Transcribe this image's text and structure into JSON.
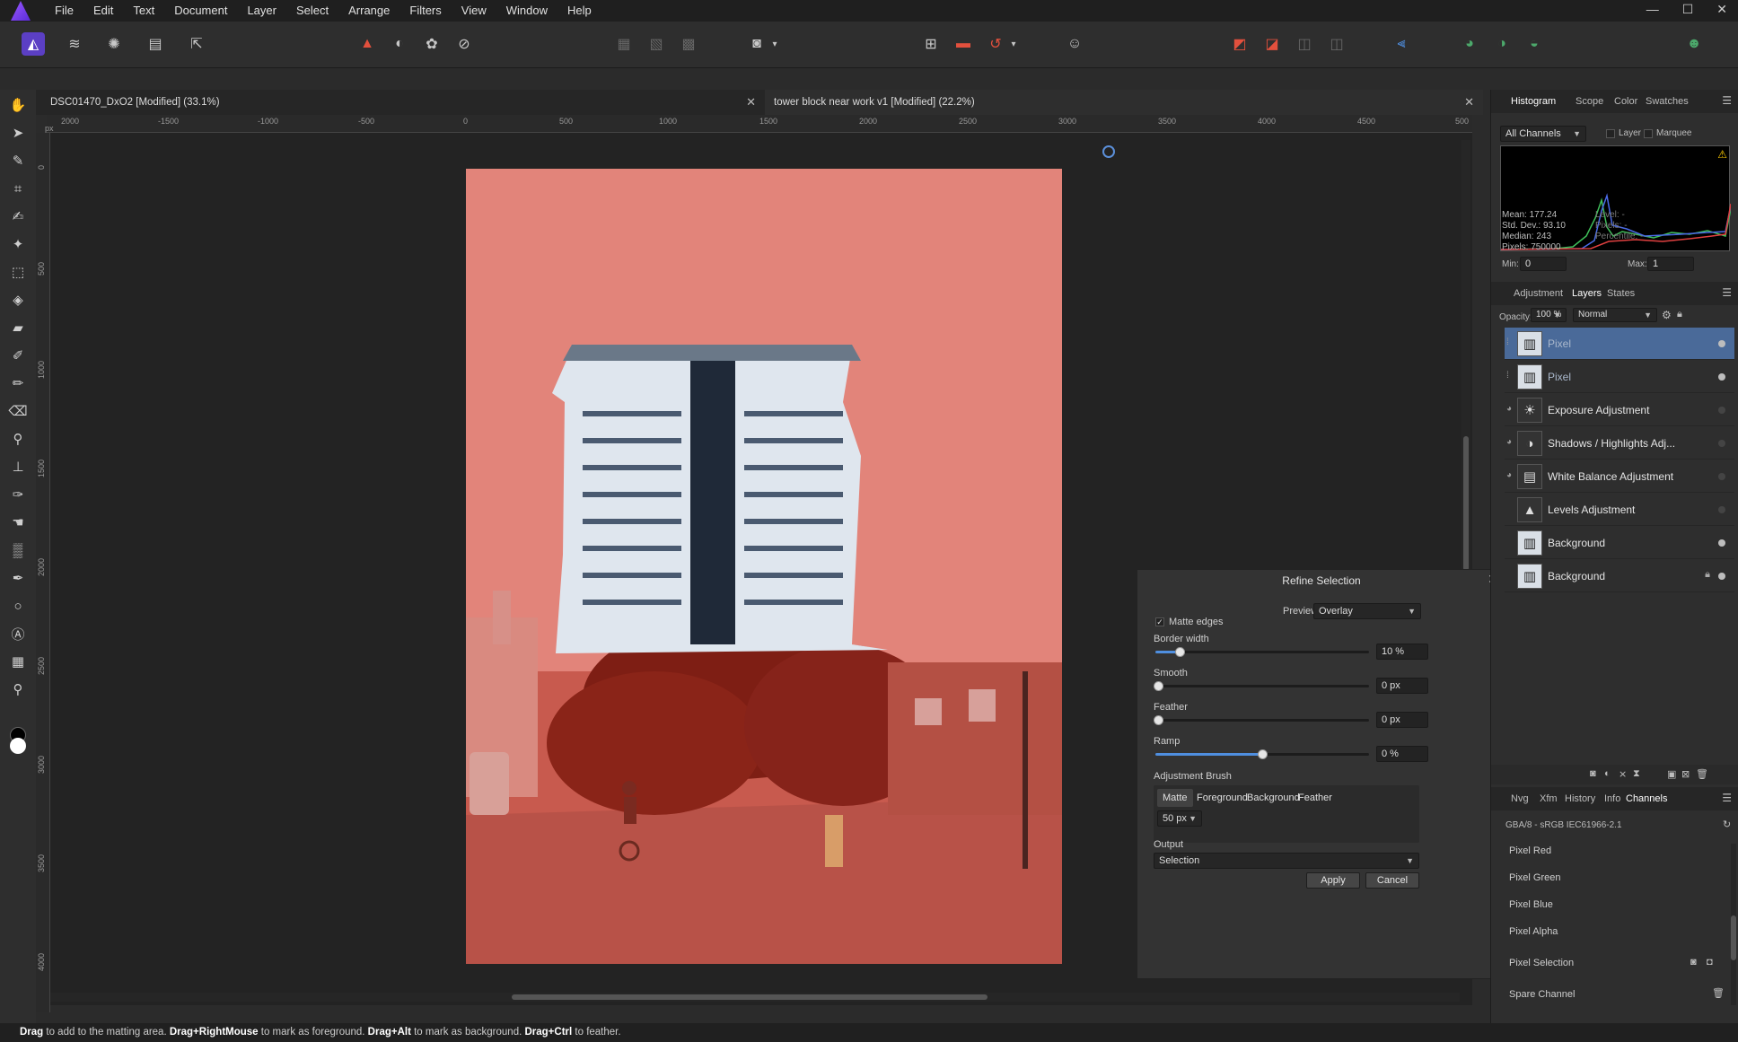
{
  "menubar": {
    "items": [
      "File",
      "Edit",
      "Text",
      "Document",
      "Layer",
      "Select",
      "Arrange",
      "Filters",
      "View",
      "Window",
      "Help"
    ],
    "window_controls": [
      "—",
      "☐",
      "✕"
    ]
  },
  "tabs": [
    {
      "title": "DSC01470_DxO2 [Modified] (33.1%)"
    },
    {
      "title": "tower block near work v1 [Modified] (22.2%)"
    }
  ],
  "ruler": {
    "h_labels": [
      "2000",
      "-1500",
      "-1000",
      "-500",
      "0",
      "500",
      "1000",
      "1500",
      "2000",
      "2500",
      "3000",
      "3500",
      "4000",
      "4500",
      "500"
    ],
    "unit": "px",
    "v_labels": [
      "0",
      "500",
      "1000",
      "1500",
      "2000",
      "2500",
      "3000",
      "3500",
      "4000"
    ]
  },
  "refine": {
    "title": "Refine Selection",
    "preview_label": "Preview",
    "preview_value": "Overlay",
    "matte_edges_label": "Matte edges",
    "matte_edges_checked": true,
    "sliders": [
      {
        "label": "Border width",
        "value": "10 %",
        "fraction": 0.11
      },
      {
        "label": "Smooth",
        "value": "0 px",
        "fraction": 0.0
      },
      {
        "label": "Feather",
        "value": "0 px",
        "fraction": 0.0
      },
      {
        "label": "Ramp",
        "value": "0 %",
        "fraction": 0.5
      }
    ],
    "brush_label": "Adjustment Brush",
    "brush_modes": [
      "Matte",
      "Foreground",
      "Background",
      "Feather"
    ],
    "brush_size": "50 px",
    "output_label": "Output",
    "output_value": "Selection",
    "apply": "Apply",
    "cancel": "Cancel"
  },
  "histogram_panel": {
    "tabs": [
      "Histogram",
      "Scope",
      "Color",
      "Swatches"
    ],
    "channel_select": "All Channels",
    "layer_label": "Layer",
    "marquee_label": "Marquee",
    "stats": [
      "Mean: 177.24",
      "Std. Dev.: 93.10",
      "Median: 243",
      "Pixels: 750000"
    ],
    "stats_right": [
      "Level: -",
      "Pixels: -",
      "Percentile: -"
    ],
    "min_label": "Min:",
    "min_value": "0",
    "max_label": "Max:",
    "max_value": "1"
  },
  "layers_panel": {
    "tabs": [
      "Adjustment",
      "Layers",
      "States"
    ],
    "opacity_label": "Opacity:",
    "opacity_value": "100 %",
    "blend_mode": "Normal",
    "layers": [
      {
        "name": "Pixel",
        "selected": true
      },
      {
        "name": "Pixel",
        "selected": false
      },
      {
        "name": "Exposure Adjustment",
        "selected": false
      },
      {
        "name": "Shadows / Highlights Adj...",
        "selected": false
      },
      {
        "name": "White Balance Adjustment",
        "selected": false
      },
      {
        "name": "Levels Adjustment",
        "selected": false
      },
      {
        "name": "Background",
        "selected": false
      },
      {
        "name": "Background",
        "selected": false,
        "locked": true
      }
    ]
  },
  "channels_panel": {
    "tabs": [
      "Nvg",
      "Xfm",
      "History",
      "Info",
      "Channels"
    ],
    "profile": "GBA/8 - sRGB IEC61966-2.1",
    "channels": [
      "Pixel Red",
      "Pixel Green",
      "Pixel Blue",
      "Pixel Alpha",
      "Pixel Selection",
      "Spare Channel"
    ]
  },
  "statusbar": {
    "parts": [
      {
        "text": "Drag",
        "bold": true
      },
      {
        "text": " to add to the matting area. ",
        "bold": false
      },
      {
        "text": "Drag+RightMouse",
        "bold": true
      },
      {
        "text": " to mark as foreground. ",
        "bold": false
      },
      {
        "text": "Drag+Alt",
        "bold": true
      },
      {
        "text": " to mark as background. ",
        "bold": false
      },
      {
        "text": "Drag+Ctrl",
        "bold": true
      },
      {
        "text": " to feather.",
        "bold": false
      }
    ]
  },
  "colors": {
    "accent": "#4f8fe0",
    "overlay": "#e2847a",
    "selected_layer": "#4a6a99"
  }
}
